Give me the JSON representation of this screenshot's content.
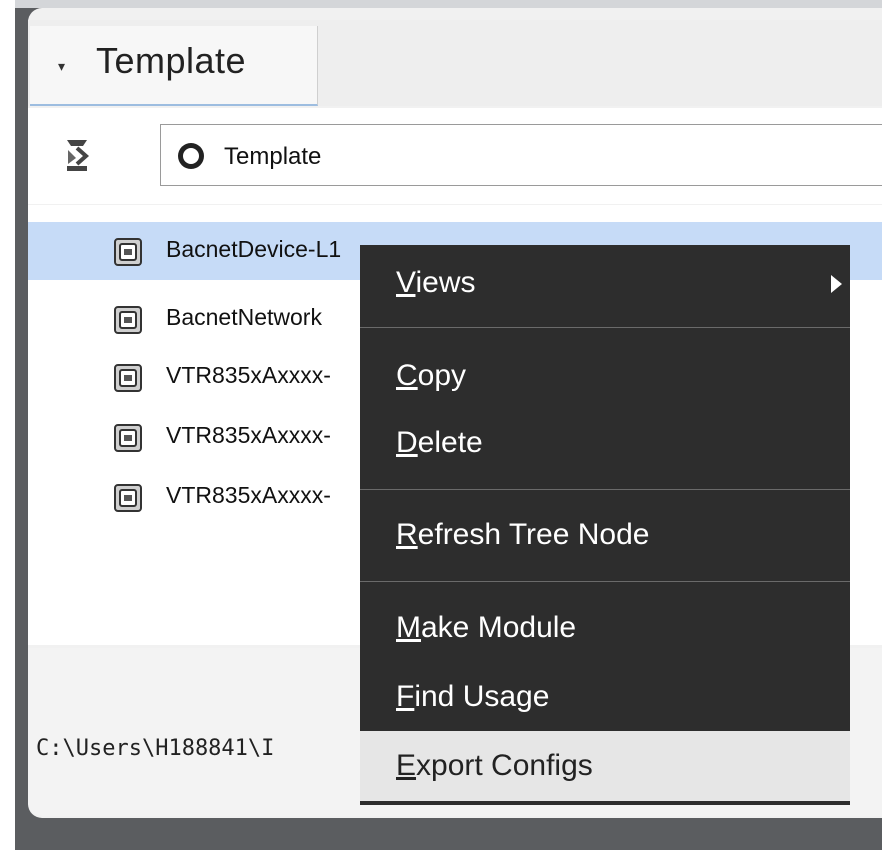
{
  "tab": {
    "label": "Template",
    "caret": "▾"
  },
  "toolbar": {
    "path_label": "Template"
  },
  "tree": {
    "items": [
      {
        "label": "BacnetDevice-L1",
        "selected": true
      },
      {
        "label": "BacnetNetwork"
      },
      {
        "label": "VTR835xAxxxx-"
      },
      {
        "label": "VTR835xAxxxx-"
      },
      {
        "label": "VTR835xAxxxx-"
      }
    ]
  },
  "console": {
    "text": "C:\\Users\\H188841\\I"
  },
  "context_menu": {
    "items": [
      {
        "mnemonic": "V",
        "rest": "iews",
        "has_submenu": true
      },
      {
        "mnemonic": "C",
        "rest": "opy"
      },
      {
        "mnemonic": "D",
        "rest": "elete"
      },
      {
        "mnemonic": "R",
        "rest": "efresh Tree Node"
      },
      {
        "mnemonic": "M",
        "rest": "ake Module"
      },
      {
        "mnemonic": "F",
        "rest": "ind Usage"
      },
      {
        "mnemonic": "E",
        "rest": "xport Configs",
        "hovered": true
      }
    ]
  },
  "colors": {
    "selection": "#c6dbf7",
    "menu_bg": "#2d2d2d",
    "menu_hover": "#e6e6e6"
  }
}
